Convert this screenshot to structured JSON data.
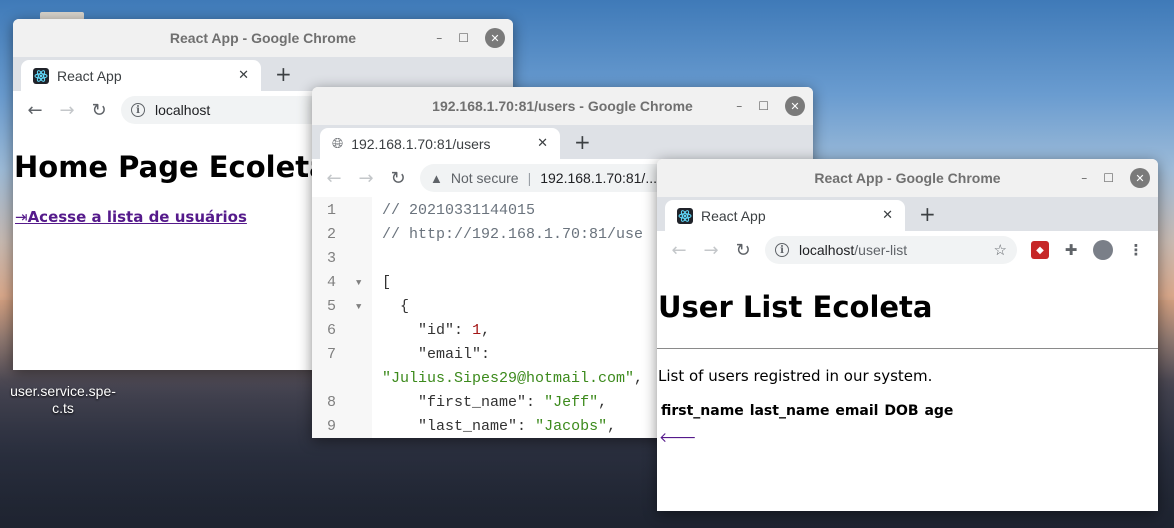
{
  "desktop": {
    "file_label": "user.service.spe-c.ts"
  },
  "window_home": {
    "title": "React App - Google Chrome",
    "tab_title": "React App",
    "url": "localhost",
    "heading": "Home Page Ecoleta",
    "link_text": "Acesse a lista de usuários",
    "link_icon": "sign-in-icon"
  },
  "window_users_json": {
    "title": "192.168.1.70:81/users - Google Chrome",
    "tab_title": "192.168.1.70:81/users",
    "security_label": "Not secure",
    "url": "192.168.1.70:81/...",
    "line_numbers": [
      "1",
      "2",
      "3",
      "4",
      "5",
      "6",
      "7",
      "",
      "8",
      "9"
    ],
    "lines": [
      "// 20210331144015",
      "// http://192.168.1.70:81/use",
      "",
      "[",
      "  {",
      "    \"id\": 1,",
      "    \"email\":",
      "\"Julius.Sipes29@hotmail.com\",",
      "    \"first_name\": \"Jeff\",",
      "    \"last_name\": \"Jacobs\","
    ]
  },
  "window_user_list": {
    "title": "React App - Google Chrome",
    "tab_title": "React App",
    "url_host": "localhost",
    "url_path": "/user-list",
    "heading": "User List Ecoleta",
    "description": "List of users registred in our system.",
    "table_headers": [
      "first_name",
      "last_name",
      "email",
      "DOB",
      "age"
    ],
    "back_icon": "arrow-left-icon"
  },
  "colors": {
    "link": "#551a8b",
    "json_string": "#3c8a1c",
    "json_number": "#a31515",
    "comment": "#6a737d"
  }
}
